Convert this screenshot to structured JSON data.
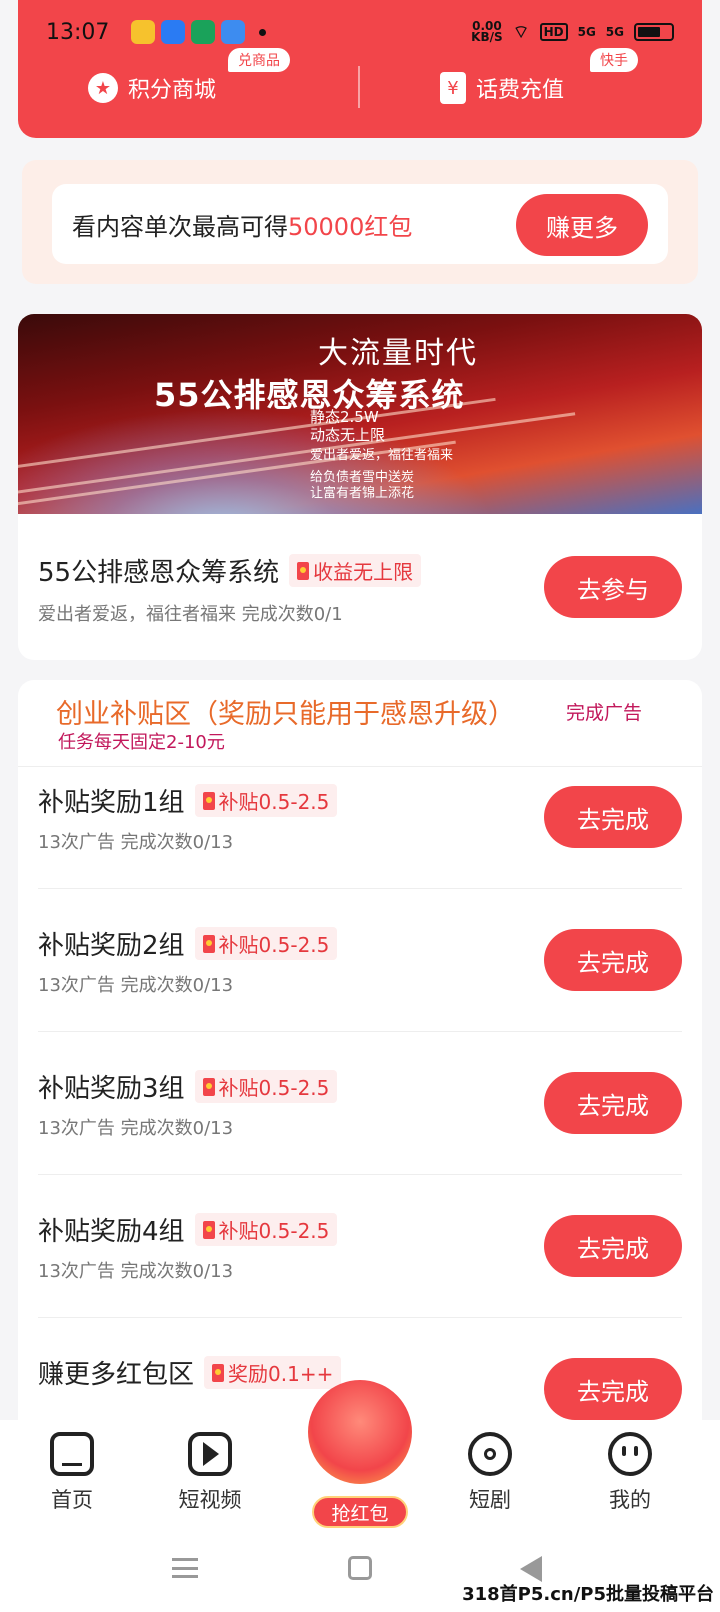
{
  "status_bar": {
    "time": "13:07",
    "net_speed": "0.00\nKB/S",
    "hd": "HD",
    "sig1": "5G",
    "sig2": "5G"
  },
  "quick_links": [
    {
      "label": "积分商城",
      "tag": "兑商品"
    },
    {
      "label": "话费充值",
      "tag": "快手"
    }
  ],
  "promo": {
    "text_prefix": "看内容单次最高可得",
    "text_highlight": "50000红包",
    "button": "赚更多"
  },
  "banner": {
    "line1": "大流量时代",
    "line2": "55公排感恩众筹系统",
    "line3": "静态2.5W",
    "line4": "动态无上限",
    "line5": "爱出者爱返，福往者福来",
    "line6": "给负债者雪中送炭",
    "line7": "让富有者锦上添花"
  },
  "featured_task": {
    "title": "55公排感恩众筹系统",
    "badge": "收益无上限",
    "sub": "爱出者爱返，福往者福来  完成次数0/1",
    "button": "去参与"
  },
  "section": {
    "title": "创业补贴区（奖励只能用于感恩升级）",
    "right": "完成广告",
    "sub": "任务每天固定2-10元"
  },
  "tasks": [
    {
      "title": "补贴奖励1组",
      "badge": "补贴0.5-2.5",
      "sub": "13次广告  完成次数0/13",
      "button": "去完成"
    },
    {
      "title": "补贴奖励2组",
      "badge": "补贴0.5-2.5",
      "sub": "13次广告  完成次数0/13",
      "button": "去完成"
    },
    {
      "title": "补贴奖励3组",
      "badge": "补贴0.5-2.5",
      "sub": "13次广告  完成次数0/13",
      "button": "去完成"
    },
    {
      "title": "补贴奖励4组",
      "badge": "补贴0.5-2.5",
      "sub": "13次广告  完成次数0/13",
      "button": "去完成"
    },
    {
      "title": "赚更多红包区",
      "badge": "奖励0.1++",
      "sub": "",
      "button": "去完成"
    }
  ],
  "bottom_nav": [
    {
      "label": "首页",
      "icon": "home-icon"
    },
    {
      "label": "短视频",
      "icon": "play-icon"
    },
    {
      "label": "抢红包",
      "icon": "red-packet-icon"
    },
    {
      "label": "短剧",
      "icon": "film-reel-icon"
    },
    {
      "label": "我的",
      "icon": "profile-icon"
    }
  ],
  "watermark": "318首P5.cn/P5批量投稿平台",
  "colors": {
    "brand_red": "#f2454a",
    "section_orange": "#e86a2a",
    "section_magenta": "#c2185b"
  }
}
